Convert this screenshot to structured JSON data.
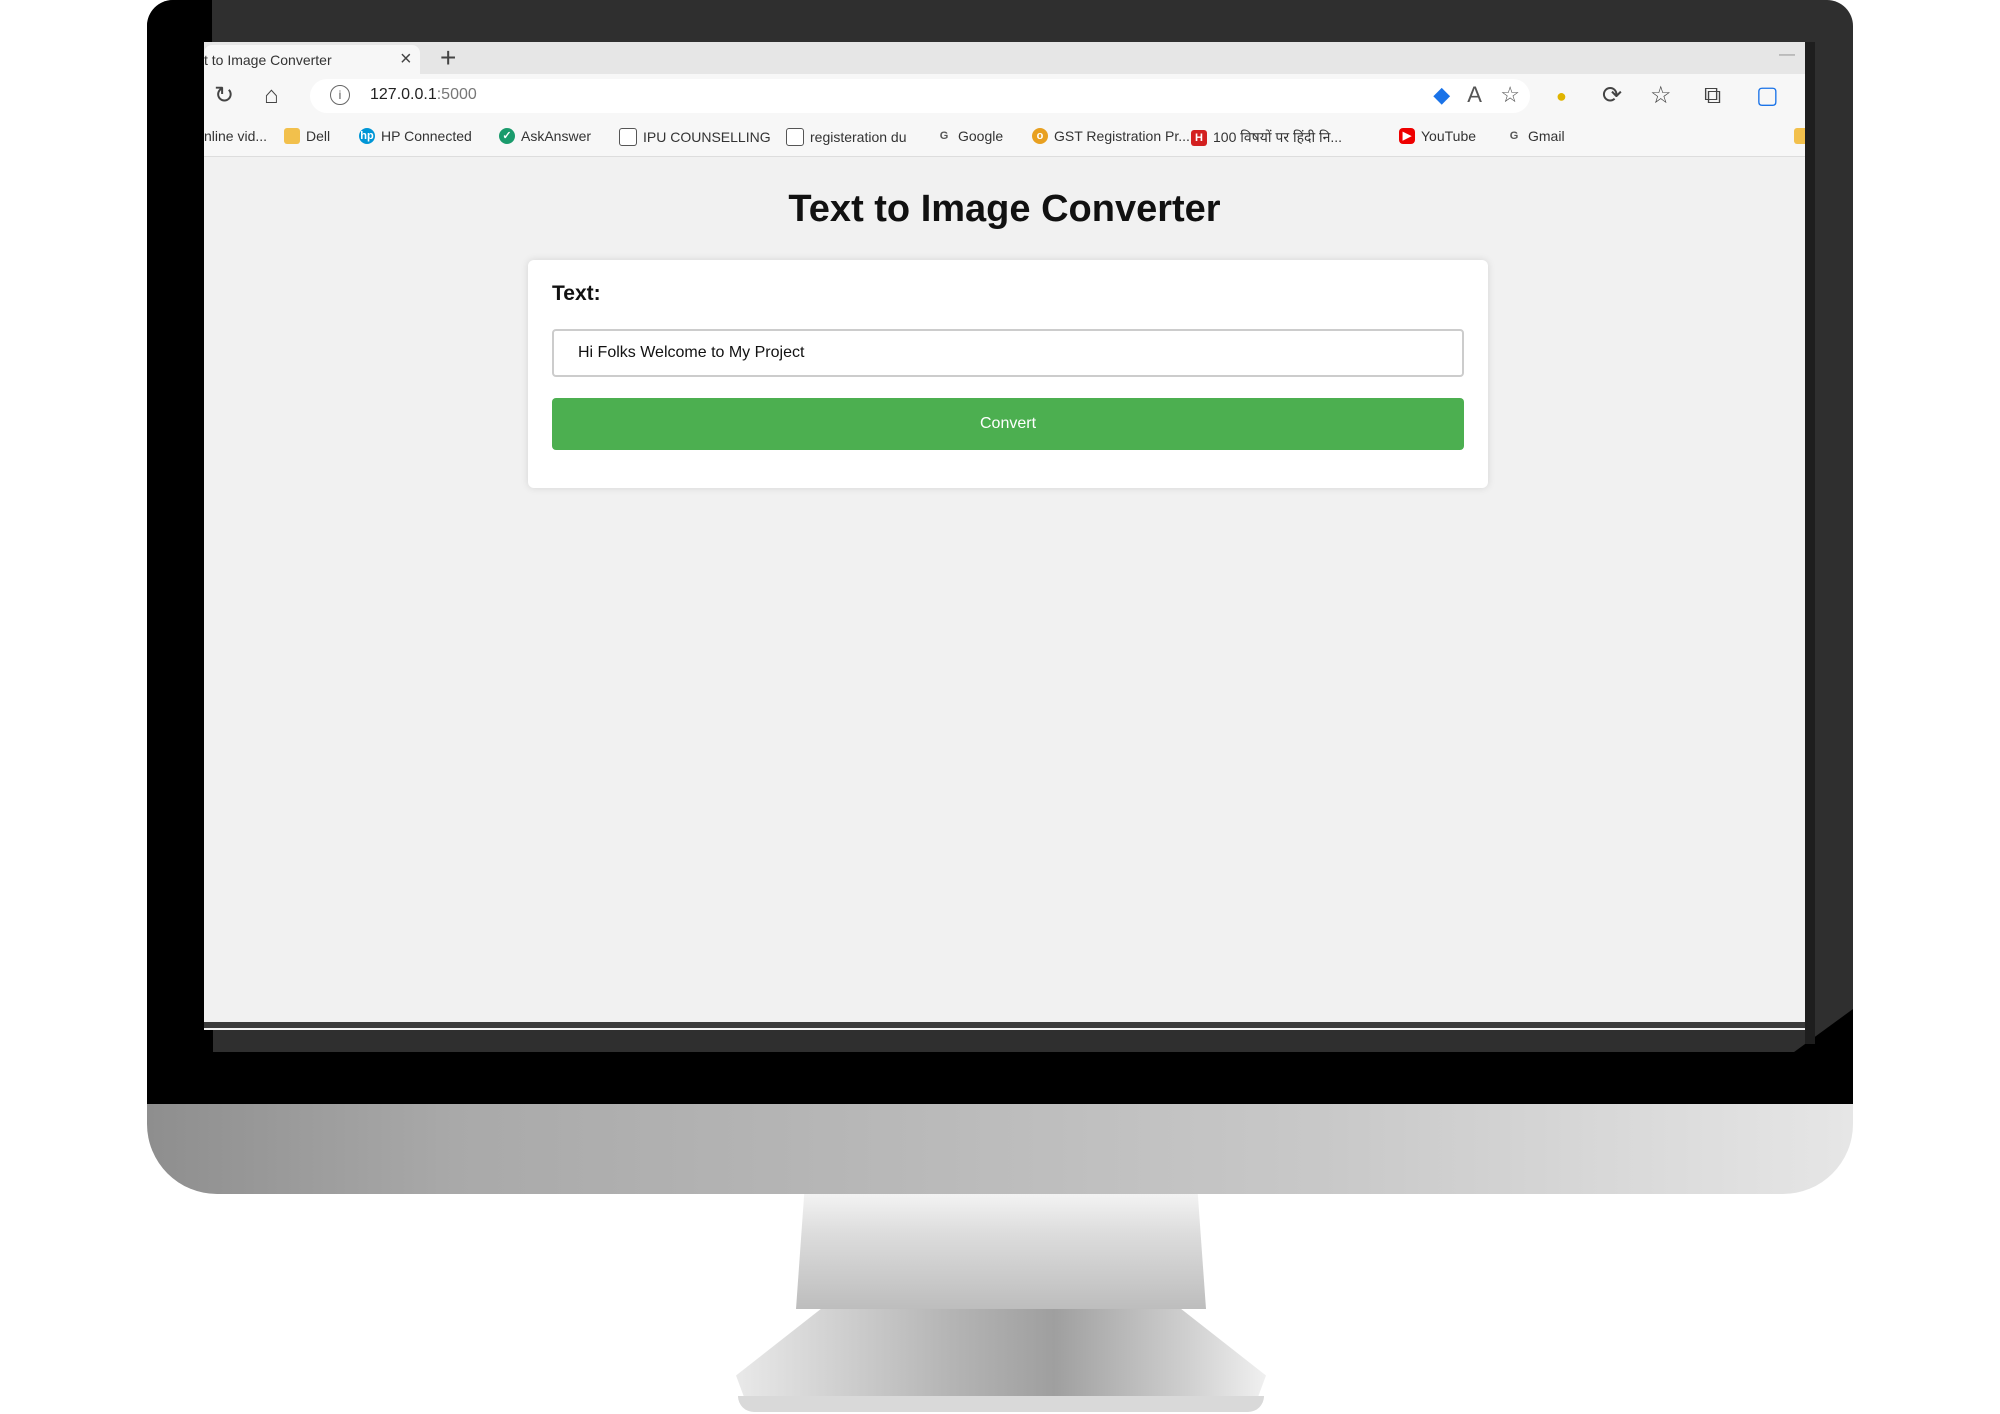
{
  "browser": {
    "tab_title": "t to Image Converter",
    "tab_close": "×",
    "new_tab": "+",
    "url_host": "127.0.0.1",
    "url_port": ":5000"
  },
  "bookmarks": [
    {
      "label": "nline vid...",
      "icon": "bookmark-icon"
    },
    {
      "label": "Dell",
      "icon": "folder-icon"
    },
    {
      "label": "HP Connected",
      "icon": "hp-icon"
    },
    {
      "label": "AskAnswer",
      "icon": "check-circle-icon"
    },
    {
      "label": "IPU COUNSELLING",
      "icon": "document-icon"
    },
    {
      "label": "registeration du",
      "icon": "document-icon"
    },
    {
      "label": "Google",
      "icon": "google-icon"
    },
    {
      "label": "GST Registration Pr...",
      "icon": "circle-logo-icon"
    },
    {
      "label": "100 विषयों पर हिंदी नि...",
      "icon": "red-square-icon"
    },
    {
      "label": "YouTube",
      "icon": "youtube-icon"
    },
    {
      "label": "Gmail",
      "icon": "google-icon"
    }
  ],
  "page": {
    "title": "Text to Image Converter",
    "text_label": "Text:",
    "text_value": "Hi Folks Welcome to My Project",
    "convert_label": "Convert"
  },
  "colors": {
    "button": "#4caf50",
    "page_bg": "#f1f1f1"
  }
}
